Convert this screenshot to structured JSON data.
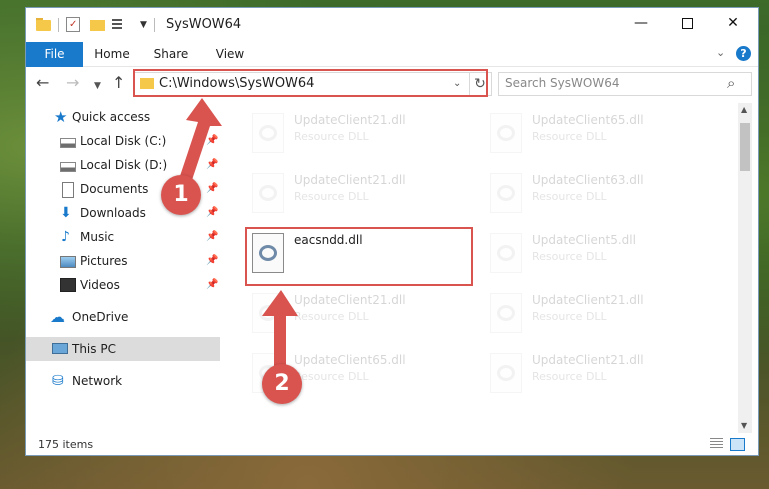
{
  "window": {
    "title": "SysWOW64",
    "controls": {
      "minimize": "—",
      "maximize": "",
      "close": "✕"
    }
  },
  "ribbon": {
    "tabs": [
      "File",
      "Home",
      "Share",
      "View"
    ],
    "help": "?"
  },
  "nav": {
    "address": "C:\\Windows\\SysWOW64",
    "search_placeholder": "Search SysWOW64"
  },
  "sidebar": {
    "items": [
      {
        "label": "Quick access",
        "icon": "star-icon"
      },
      {
        "label": "Local Disk (C:)",
        "icon": "drive-icon",
        "pinned": true
      },
      {
        "label": "Local Disk (D:)",
        "icon": "drive-icon",
        "pinned": true
      },
      {
        "label": "Documents",
        "icon": "documents-icon",
        "pinned": true
      },
      {
        "label": "Downloads",
        "icon": "download-icon",
        "pinned": true
      },
      {
        "label": "Music",
        "icon": "music-icon",
        "pinned": true
      },
      {
        "label": "Pictures",
        "icon": "pictures-icon",
        "pinned": true
      },
      {
        "label": "Videos",
        "icon": "videos-icon",
        "pinned": true
      },
      {
        "label": "OneDrive",
        "icon": "cloud-icon"
      },
      {
        "label": "This PC",
        "icon": "computer-icon",
        "selected": true
      },
      {
        "label": "Network",
        "icon": "network-icon"
      }
    ]
  },
  "files": [
    {
      "name": "UpdateClient21.dll",
      "type": "Resource DLL"
    },
    {
      "name": "UpdateClient65.dll",
      "type": "Resource DLL"
    },
    {
      "name": "UpdateClient21.dll",
      "type": "Resource DLL"
    },
    {
      "name": "UpdateClient63.dll",
      "type": "Resource DLL"
    },
    {
      "name": "eacsndd.dll",
      "type": ""
    },
    {
      "name": "UpdateClient5.dll",
      "type": "Resource DLL"
    },
    {
      "name": "UpdateClient21.dll",
      "type": "Resource DLL"
    },
    {
      "name": "UpdateClient21.dll",
      "type": "Resource DLL"
    },
    {
      "name": "UpdateClient65.dll",
      "type": "Resource DLL"
    },
    {
      "name": "UpdateClient21.dll",
      "type": "Resource DLL"
    }
  ],
  "status": {
    "item_count": "175 items"
  },
  "annotations": {
    "step1": "1",
    "step2": "2",
    "color": "#d9534f"
  }
}
